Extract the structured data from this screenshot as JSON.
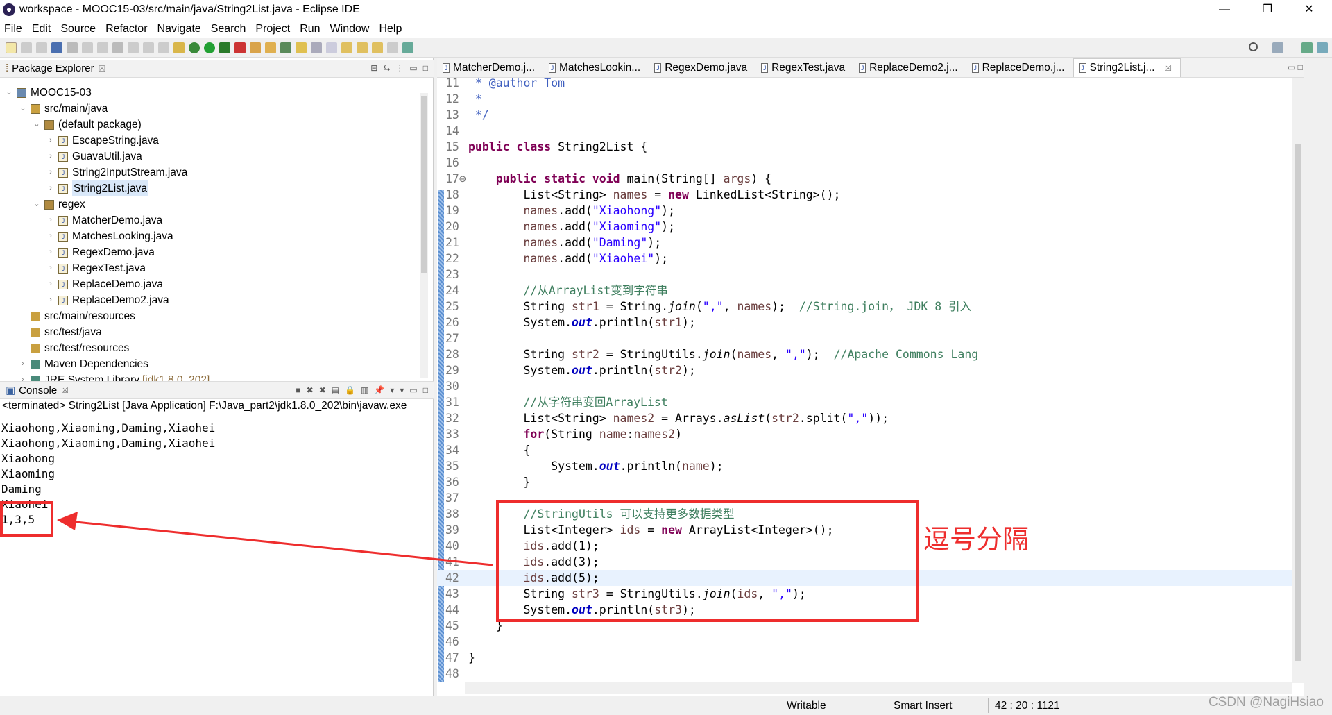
{
  "window": {
    "title": "workspace - MOOC15-03/src/main/java/String2List.java - Eclipse IDE",
    "minimize": "—",
    "restore": "❐",
    "close": "✕"
  },
  "menu": [
    "File",
    "Edit",
    "Source",
    "Refactor",
    "Navigate",
    "Search",
    "Project",
    "Run",
    "Window",
    "Help"
  ],
  "package_explorer": {
    "title": "Package Explorer",
    "items": [
      {
        "label": "MOOC15-03",
        "level": 0,
        "chev": "v",
        "icon": "project"
      },
      {
        "label": "src/main/java",
        "level": 1,
        "chev": "v",
        "icon": "source-folder"
      },
      {
        "label": "(default package)",
        "level": 2,
        "chev": "v",
        "icon": "package"
      },
      {
        "label": "EscapeString.java",
        "level": 3,
        "chev": ">",
        "icon": "java-file"
      },
      {
        "label": "GuavaUtil.java",
        "level": 3,
        "chev": ">",
        "icon": "java-file"
      },
      {
        "label": "String2InputStream.java",
        "level": 3,
        "chev": ">",
        "icon": "java-file"
      },
      {
        "label": "String2List.java",
        "level": 3,
        "chev": ">",
        "icon": "java-file",
        "selected": true
      },
      {
        "label": "regex",
        "level": 2,
        "chev": "v",
        "icon": "package"
      },
      {
        "label": "MatcherDemo.java",
        "level": 3,
        "chev": ">",
        "icon": "java-file"
      },
      {
        "label": "MatchesLooking.java",
        "level": 3,
        "chev": ">",
        "icon": "java-file"
      },
      {
        "label": "RegexDemo.java",
        "level": 3,
        "chev": ">",
        "icon": "java-file"
      },
      {
        "label": "RegexTest.java",
        "level": 3,
        "chev": ">",
        "icon": "java-file"
      },
      {
        "label": "ReplaceDemo.java",
        "level": 3,
        "chev": ">",
        "icon": "java-file"
      },
      {
        "label": "ReplaceDemo2.java",
        "level": 3,
        "chev": ">",
        "icon": "java-file"
      },
      {
        "label": "src/main/resources",
        "level": 1,
        "chev": "",
        "icon": "folder"
      },
      {
        "label": "src/test/java",
        "level": 1,
        "chev": "",
        "icon": "folder"
      },
      {
        "label": "src/test/resources",
        "level": 1,
        "chev": "",
        "icon": "folder"
      },
      {
        "label": "Maven Dependencies",
        "level": 1,
        "chev": ">",
        "icon": "library"
      },
      {
        "label": "JRE System Library",
        "level": 1,
        "chev": ">",
        "icon": "library",
        "suffix": "[jdk1.8.0_202]"
      }
    ]
  },
  "console": {
    "title": "Console",
    "status": "<terminated> String2List [Java Application] F:\\Java_part2\\jdk1.8.0_202\\bin\\javaw.exe",
    "output": [
      "Xiaohong,Xiaoming,Daming,Xiaohei",
      "Xiaohong,Xiaoming,Daming,Xiaohei",
      "Xiaohong",
      "Xiaoming",
      "Daming",
      "Xiaohei",
      "1,3,5"
    ]
  },
  "editor": {
    "tabs": [
      {
        "label": "MatcherDemo.j..."
      },
      {
        "label": "MatchesLookin..."
      },
      {
        "label": "RegexDemo.java"
      },
      {
        "label": "RegexTest.java"
      },
      {
        "label": "ReplaceDemo2.j..."
      },
      {
        "label": "ReplaceDemo.j..."
      },
      {
        "label": "String2List.j...",
        "active": true
      }
    ],
    "highlight_line": 42,
    "lines": [
      {
        "n": "11",
        "t": [
          [
            "j",
            " * @author Tom"
          ]
        ]
      },
      {
        "n": "12",
        "t": [
          [
            "j",
            " *"
          ]
        ]
      },
      {
        "n": "13",
        "t": [
          [
            "j",
            " */"
          ]
        ]
      },
      {
        "n": "14",
        "t": []
      },
      {
        "n": "15",
        "t": [
          [
            "k",
            "public class "
          ],
          [
            "p",
            "String2List {"
          ]
        ]
      },
      {
        "n": "16",
        "t": []
      },
      {
        "n": "17⊖",
        "t": [
          [
            "k",
            "    public static void "
          ],
          [
            "p",
            "main(String[] "
          ],
          [
            "v",
            "args"
          ],
          [
            "p",
            ") {"
          ]
        ]
      },
      {
        "n": "18",
        "t": [
          [
            "p",
            "        List<String> "
          ],
          [
            "v",
            "names"
          ],
          [
            "p",
            " = "
          ],
          [
            "k",
            "new "
          ],
          [
            "p",
            "LinkedList<String>();"
          ]
        ]
      },
      {
        "n": "19",
        "t": [
          [
            "v",
            "        names"
          ],
          [
            "p",
            ".add("
          ],
          [
            "s",
            "\"Xiaohong\""
          ],
          [
            "p",
            ");"
          ]
        ]
      },
      {
        "n": "20",
        "t": [
          [
            "v",
            "        names"
          ],
          [
            "p",
            ".add("
          ],
          [
            "s",
            "\"Xiaoming\""
          ],
          [
            "p",
            ");"
          ]
        ]
      },
      {
        "n": "21",
        "t": [
          [
            "v",
            "        names"
          ],
          [
            "p",
            ".add("
          ],
          [
            "s",
            "\"Daming\""
          ],
          [
            "p",
            ");"
          ]
        ]
      },
      {
        "n": "22",
        "t": [
          [
            "v",
            "        names"
          ],
          [
            "p",
            ".add("
          ],
          [
            "s",
            "\"Xiaohei\""
          ],
          [
            "p",
            ");"
          ]
        ]
      },
      {
        "n": "23",
        "t": []
      },
      {
        "n": "24",
        "t": [
          [
            "c",
            "        //从ArrayList变到字符串"
          ]
        ]
      },
      {
        "n": "25",
        "t": [
          [
            "p",
            "        String "
          ],
          [
            "v",
            "str1"
          ],
          [
            "p",
            " = String."
          ],
          [
            "i",
            "join"
          ],
          [
            "p",
            "("
          ],
          [
            "s",
            "\",\""
          ],
          [
            "p",
            ", "
          ],
          [
            "v",
            "names"
          ],
          [
            "p",
            ");  "
          ],
          [
            "c",
            "//String.join， JDK 8 引入"
          ]
        ]
      },
      {
        "n": "26",
        "t": [
          [
            "p",
            "        System."
          ],
          [
            "f",
            "out"
          ],
          [
            "p",
            ".println("
          ],
          [
            "v",
            "str1"
          ],
          [
            "p",
            ");"
          ]
        ]
      },
      {
        "n": "27",
        "t": []
      },
      {
        "n": "28",
        "t": [
          [
            "p",
            "        String "
          ],
          [
            "v",
            "str2"
          ],
          [
            "p",
            " = StringUtils."
          ],
          [
            "i",
            "join"
          ],
          [
            "p",
            "("
          ],
          [
            "v",
            "names"
          ],
          [
            "p",
            ", "
          ],
          [
            "s",
            "\",\""
          ],
          [
            "p",
            ");  "
          ],
          [
            "c",
            "//Apache Commons Lang"
          ]
        ]
      },
      {
        "n": "29",
        "t": [
          [
            "p",
            "        System."
          ],
          [
            "f",
            "out"
          ],
          [
            "p",
            ".println("
          ],
          [
            "v",
            "str2"
          ],
          [
            "p",
            ");"
          ]
        ]
      },
      {
        "n": "30",
        "t": []
      },
      {
        "n": "31",
        "t": [
          [
            "c",
            "        //从字符串变回ArrayList"
          ]
        ]
      },
      {
        "n": "32",
        "t": [
          [
            "p",
            "        List<String> "
          ],
          [
            "v",
            "names2"
          ],
          [
            "p",
            " = Arrays."
          ],
          [
            "i",
            "asList"
          ],
          [
            "p",
            "("
          ],
          [
            "v",
            "str2"
          ],
          [
            "p",
            ".split("
          ],
          [
            "s",
            "\",\""
          ],
          [
            "p",
            "));"
          ]
        ]
      },
      {
        "n": "33",
        "t": [
          [
            "k",
            "        for"
          ],
          [
            "p",
            "(String "
          ],
          [
            "v",
            "name"
          ],
          [
            "p",
            ":"
          ],
          [
            "v",
            "names2"
          ],
          [
            "p",
            ")"
          ]
        ]
      },
      {
        "n": "34",
        "t": [
          [
            "p",
            "        {"
          ]
        ]
      },
      {
        "n": "35",
        "t": [
          [
            "p",
            "            System."
          ],
          [
            "f",
            "out"
          ],
          [
            "p",
            ".println("
          ],
          [
            "v",
            "name"
          ],
          [
            "p",
            ");"
          ]
        ]
      },
      {
        "n": "36",
        "t": [
          [
            "p",
            "        }"
          ]
        ]
      },
      {
        "n": "37",
        "t": []
      },
      {
        "n": "38",
        "t": [
          [
            "c",
            "        //StringUtils 可以支持更多数据类型"
          ]
        ]
      },
      {
        "n": "39",
        "t": [
          [
            "p",
            "        List<Integer> "
          ],
          [
            "v",
            "ids"
          ],
          [
            "p",
            " = "
          ],
          [
            "k",
            "new "
          ],
          [
            "p",
            "ArrayList<Integer>();"
          ]
        ]
      },
      {
        "n": "40",
        "t": [
          [
            "v",
            "        ids"
          ],
          [
            "p",
            ".add(1);"
          ]
        ]
      },
      {
        "n": "41",
        "t": [
          [
            "v",
            "        ids"
          ],
          [
            "p",
            ".add(3);"
          ]
        ]
      },
      {
        "n": "42",
        "t": [
          [
            "v",
            "        ids"
          ],
          [
            "p",
            ".add(5);"
          ]
        ]
      },
      {
        "n": "43",
        "t": [
          [
            "p",
            "        String "
          ],
          [
            "v",
            "str3"
          ],
          [
            "p",
            " = StringUtils."
          ],
          [
            "i",
            "join"
          ],
          [
            "p",
            "("
          ],
          [
            "v",
            "ids"
          ],
          [
            "p",
            ", "
          ],
          [
            "s",
            "\",\""
          ],
          [
            "p",
            ");"
          ]
        ]
      },
      {
        "n": "44",
        "t": [
          [
            "p",
            "        System."
          ],
          [
            "f",
            "out"
          ],
          [
            "p",
            ".println("
          ],
          [
            "v",
            "str3"
          ],
          [
            "p",
            ");"
          ]
        ]
      },
      {
        "n": "45",
        "t": [
          [
            "p",
            "    }"
          ]
        ]
      },
      {
        "n": "46",
        "t": []
      },
      {
        "n": "47",
        "t": [
          [
            "p",
            "}"
          ]
        ]
      },
      {
        "n": "48",
        "t": []
      }
    ]
  },
  "annotation": {
    "label": "逗号分隔",
    "color": "#ee2d2d"
  },
  "status": {
    "writable": "Writable",
    "insert_mode": "Smart Insert",
    "position": "42 : 20 : 1121"
  },
  "watermark": "CSDN @NagiHsiao"
}
